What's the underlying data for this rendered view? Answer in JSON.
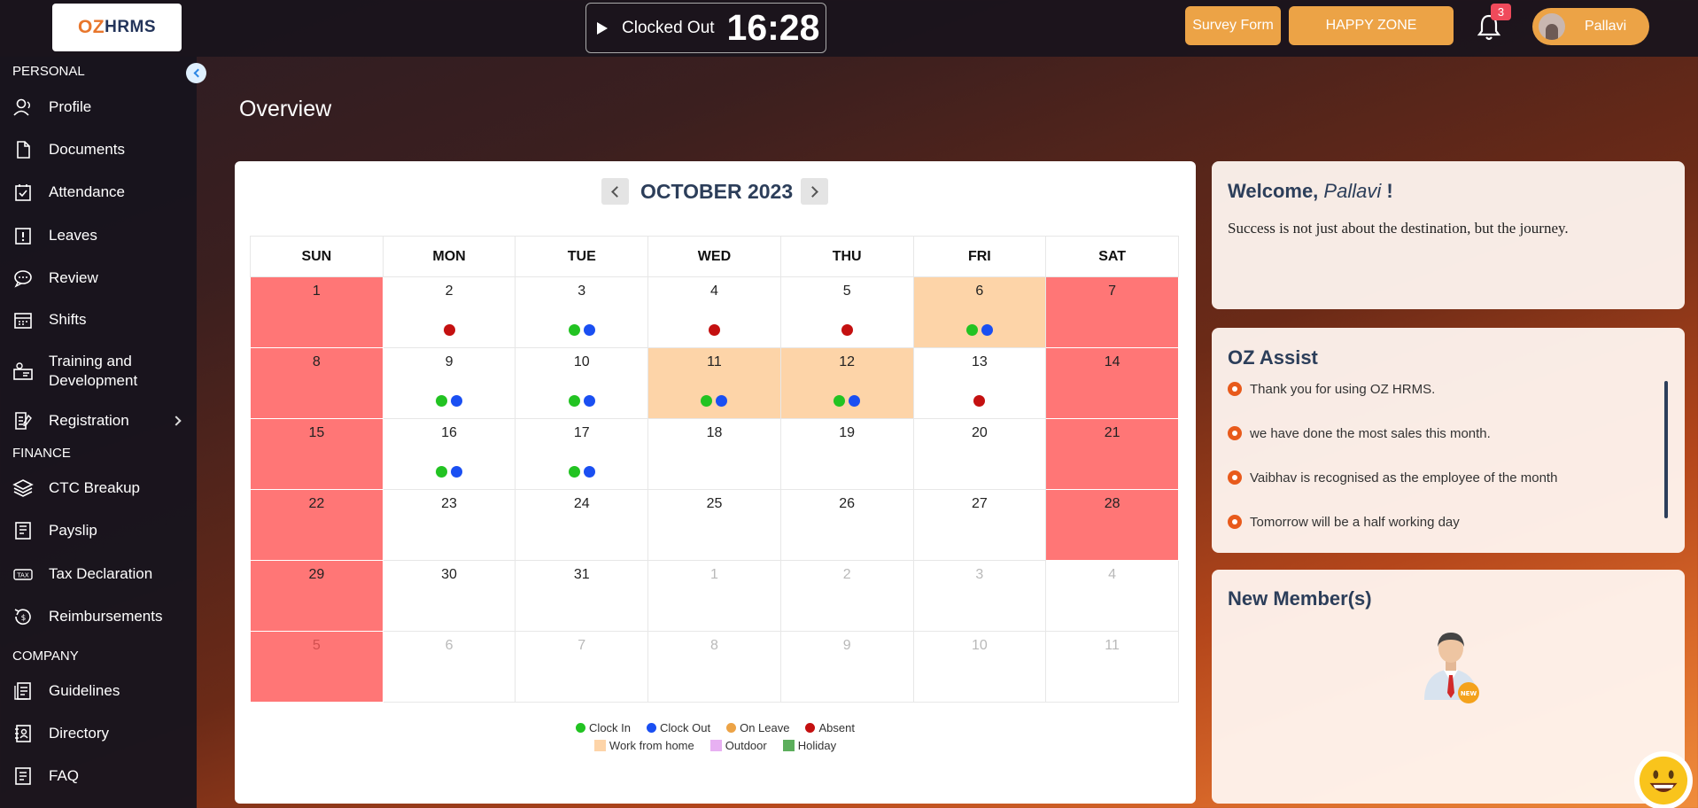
{
  "header": {
    "logo_oz": "OZ",
    "logo_hrms": "HRMS",
    "clock_status": "Clocked Out",
    "clock_time": "16:28",
    "survey_label": "Survey Form",
    "happy_label": "HAPPY ZONE",
    "notification_count": "3",
    "user_name": "Pallavi"
  },
  "sidebar": {
    "personal_heading": "PERSONAL",
    "finance_heading": "FINANCE",
    "company_heading": "COMPANY",
    "personal": [
      {
        "label": "Profile",
        "icon": "user-icon"
      },
      {
        "label": "Documents",
        "icon": "document-icon"
      },
      {
        "label": "Attendance",
        "icon": "calendar-check-icon"
      },
      {
        "label": "Leaves",
        "icon": "alert-icon"
      },
      {
        "label": "Review",
        "icon": "chat-icon"
      },
      {
        "label": "Shifts",
        "icon": "calendar-icon"
      },
      {
        "label": "Training and Development",
        "icon": "training-icon"
      },
      {
        "label": "Registration",
        "icon": "registration-icon"
      }
    ],
    "finance": [
      {
        "label": "CTC Breakup",
        "icon": "layers-icon"
      },
      {
        "label": "Payslip",
        "icon": "payslip-icon"
      },
      {
        "label": "Tax Declaration",
        "icon": "tax-icon"
      },
      {
        "label": "Reimbursements",
        "icon": "reimburse-icon"
      }
    ],
    "company": [
      {
        "label": "Guidelines",
        "icon": "guidelines-icon"
      },
      {
        "label": "Directory",
        "icon": "directory-icon"
      },
      {
        "label": "FAQ",
        "icon": "faq-icon"
      }
    ]
  },
  "page_title": "Overview",
  "calendar": {
    "month_label": "OCTOBER 2023",
    "weekdays": [
      "SUN",
      "MON",
      "TUE",
      "WED",
      "THU",
      "FRI",
      "SAT"
    ],
    "weeks": [
      [
        {
          "d": "1",
          "t": "weekend"
        },
        {
          "d": "2",
          "dots": [
            "absent"
          ]
        },
        {
          "d": "3",
          "dots": [
            "in",
            "out"
          ]
        },
        {
          "d": "4",
          "dots": [
            "absent"
          ]
        },
        {
          "d": "5",
          "dots": [
            "absent"
          ]
        },
        {
          "d": "6",
          "t": "wfh",
          "dots": [
            "in",
            "out"
          ]
        },
        {
          "d": "7",
          "t": "weekend"
        }
      ],
      [
        {
          "d": "8",
          "t": "weekend"
        },
        {
          "d": "9",
          "dots": [
            "in",
            "out"
          ]
        },
        {
          "d": "10",
          "dots": [
            "in",
            "out"
          ]
        },
        {
          "d": "11",
          "t": "wfh",
          "dots": [
            "in",
            "out"
          ]
        },
        {
          "d": "12",
          "t": "wfh",
          "dots": [
            "in",
            "out"
          ]
        },
        {
          "d": "13",
          "dots": [
            "absent"
          ]
        },
        {
          "d": "14",
          "t": "weekend"
        }
      ],
      [
        {
          "d": "15",
          "t": "weekend"
        },
        {
          "d": "16",
          "dots": [
            "in",
            "out"
          ]
        },
        {
          "d": "17",
          "dots": [
            "in",
            "out"
          ]
        },
        {
          "d": "18"
        },
        {
          "d": "19"
        },
        {
          "d": "20"
        },
        {
          "d": "21",
          "t": "weekend"
        }
      ],
      [
        {
          "d": "22",
          "t": "weekend"
        },
        {
          "d": "23"
        },
        {
          "d": "24"
        },
        {
          "d": "25"
        },
        {
          "d": "26"
        },
        {
          "d": "27"
        },
        {
          "d": "28",
          "t": "weekend"
        }
      ],
      [
        {
          "d": "29",
          "t": "weekend"
        },
        {
          "d": "30"
        },
        {
          "d": "31"
        },
        {
          "d": "1",
          "o": true
        },
        {
          "d": "2",
          "o": true
        },
        {
          "d": "3",
          "o": true
        },
        {
          "d": "4",
          "o": true
        }
      ],
      [
        {
          "d": "5",
          "t": "weekend",
          "o": true
        },
        {
          "d": "6",
          "o": true
        },
        {
          "d": "7",
          "o": true
        },
        {
          "d": "8",
          "o": true
        },
        {
          "d": "9",
          "o": true
        },
        {
          "d": "10",
          "o": true
        },
        {
          "d": "11",
          "o": true
        }
      ]
    ],
    "dot_colors": {
      "in": "#22c322",
      "out": "#1a4ff2",
      "leave": "#eca346",
      "absent": "#c41010"
    },
    "legend_dots": [
      {
        "label": "Clock In",
        "color": "#22c322"
      },
      {
        "label": "Clock Out",
        "color": "#1a4ff2"
      },
      {
        "label": "On Leave",
        "color": "#eca346"
      },
      {
        "label": "Absent",
        "color": "#c41010"
      }
    ],
    "legend_boxes": [
      {
        "label": "Work from home",
        "color": "#fdd4a8"
      },
      {
        "label": "Outdoor",
        "color": "#e7b0f2"
      },
      {
        "label": "Holiday",
        "color": "#5cae5c"
      }
    ]
  },
  "welcome": {
    "prefix": "Welcome, ",
    "name": "Pallavi",
    "suffix": " !",
    "quote": "Success is not just about the destination, but the journey."
  },
  "assist": {
    "title": "OZ Assist",
    "items": [
      "Thank you for using OZ HRMS.",
      "we have done the most sales this month.",
      "Vaibhav is recognised as the employee of the month",
      "Tomorrow will be a half working day"
    ]
  },
  "members": {
    "title": "New Member(s)",
    "badge": "NEW"
  }
}
